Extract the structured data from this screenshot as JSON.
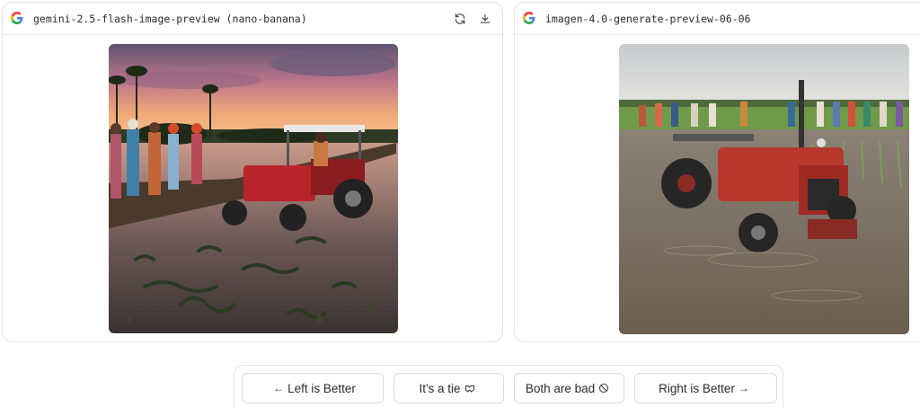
{
  "left_panel": {
    "model_name": "gemini-2.5-flash-image-preview (nano-banana)",
    "logo_icon": "google-g-icon",
    "actions": [
      "refresh-icon",
      "download-icon"
    ]
  },
  "right_panel": {
    "model_name": "imagen-4.0-generate-preview-06-06",
    "logo_icon": "google-g-icon"
  },
  "vote_bar": {
    "left_label": "Left is Better",
    "tie_label": "It's a tie",
    "bad_label": "Both are bad",
    "right_label": "Right is Better"
  },
  "colors": {
    "g_blue": "#4285F4",
    "g_red": "#EA4335",
    "g_yellow": "#FBBC05",
    "g_green": "#34A853"
  }
}
